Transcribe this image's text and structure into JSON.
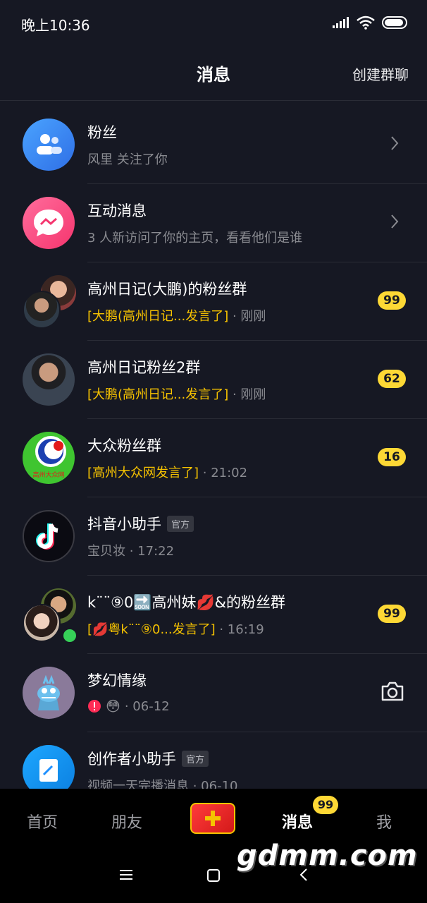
{
  "status_bar": {
    "time": "晚上10:36"
  },
  "header": {
    "title": "消息",
    "create_group": "创建群聊"
  },
  "messages": [
    {
      "name": "粉丝",
      "sub": "风里 关注了你",
      "has_chevron": true
    },
    {
      "name": "互动消息",
      "sub": "3 人新访问了你的主页，看看他们是谁",
      "has_chevron": true
    },
    {
      "name": "高州日记(大鹏)的粉丝群",
      "sub_highlight": "[大鹏(高州日记...发言了]",
      "sub_time": " · 刚刚",
      "badge": "99"
    },
    {
      "name": "高州日记粉丝2群",
      "sub_highlight": "[大鹏(高州日记...发言了]",
      "sub_time": " · 刚刚",
      "badge": "62"
    },
    {
      "name": "大众粉丝群",
      "sub_highlight": "[高州大众网发言了]",
      "sub_time": " · 21:02",
      "badge": "16",
      "avatar_text": "高州大众网"
    },
    {
      "name": "抖音小助手",
      "tag": "官方",
      "sub": "宝贝妆 · 17:22"
    },
    {
      "name": "k¨¨⑨0🔜高州妹💋&的粉丝群",
      "sub_highlight": "[💋粤k¨¨⑨0...发言了]",
      "sub_time": " · 16:19",
      "badge": "99"
    },
    {
      "name": "梦幻情缘",
      "sub_emoji": "😳",
      "sub_time": " · 06-12",
      "has_camera": true
    },
    {
      "name": "创作者小助手",
      "tag": "官方",
      "sub": "视频一天完播消息 · 06-10"
    }
  ],
  "tabs": [
    {
      "label": "首页",
      "active": false
    },
    {
      "label": "朋友",
      "active": false
    },
    {
      "label": "消息",
      "active": true,
      "badge": "99"
    },
    {
      "label": "我",
      "active": false
    }
  ],
  "watermark": "gdmm.com",
  "colors": {
    "background": "#161823",
    "badge": "#fdd835",
    "highlight": "#f7c300",
    "separator": "#2a2c36"
  }
}
